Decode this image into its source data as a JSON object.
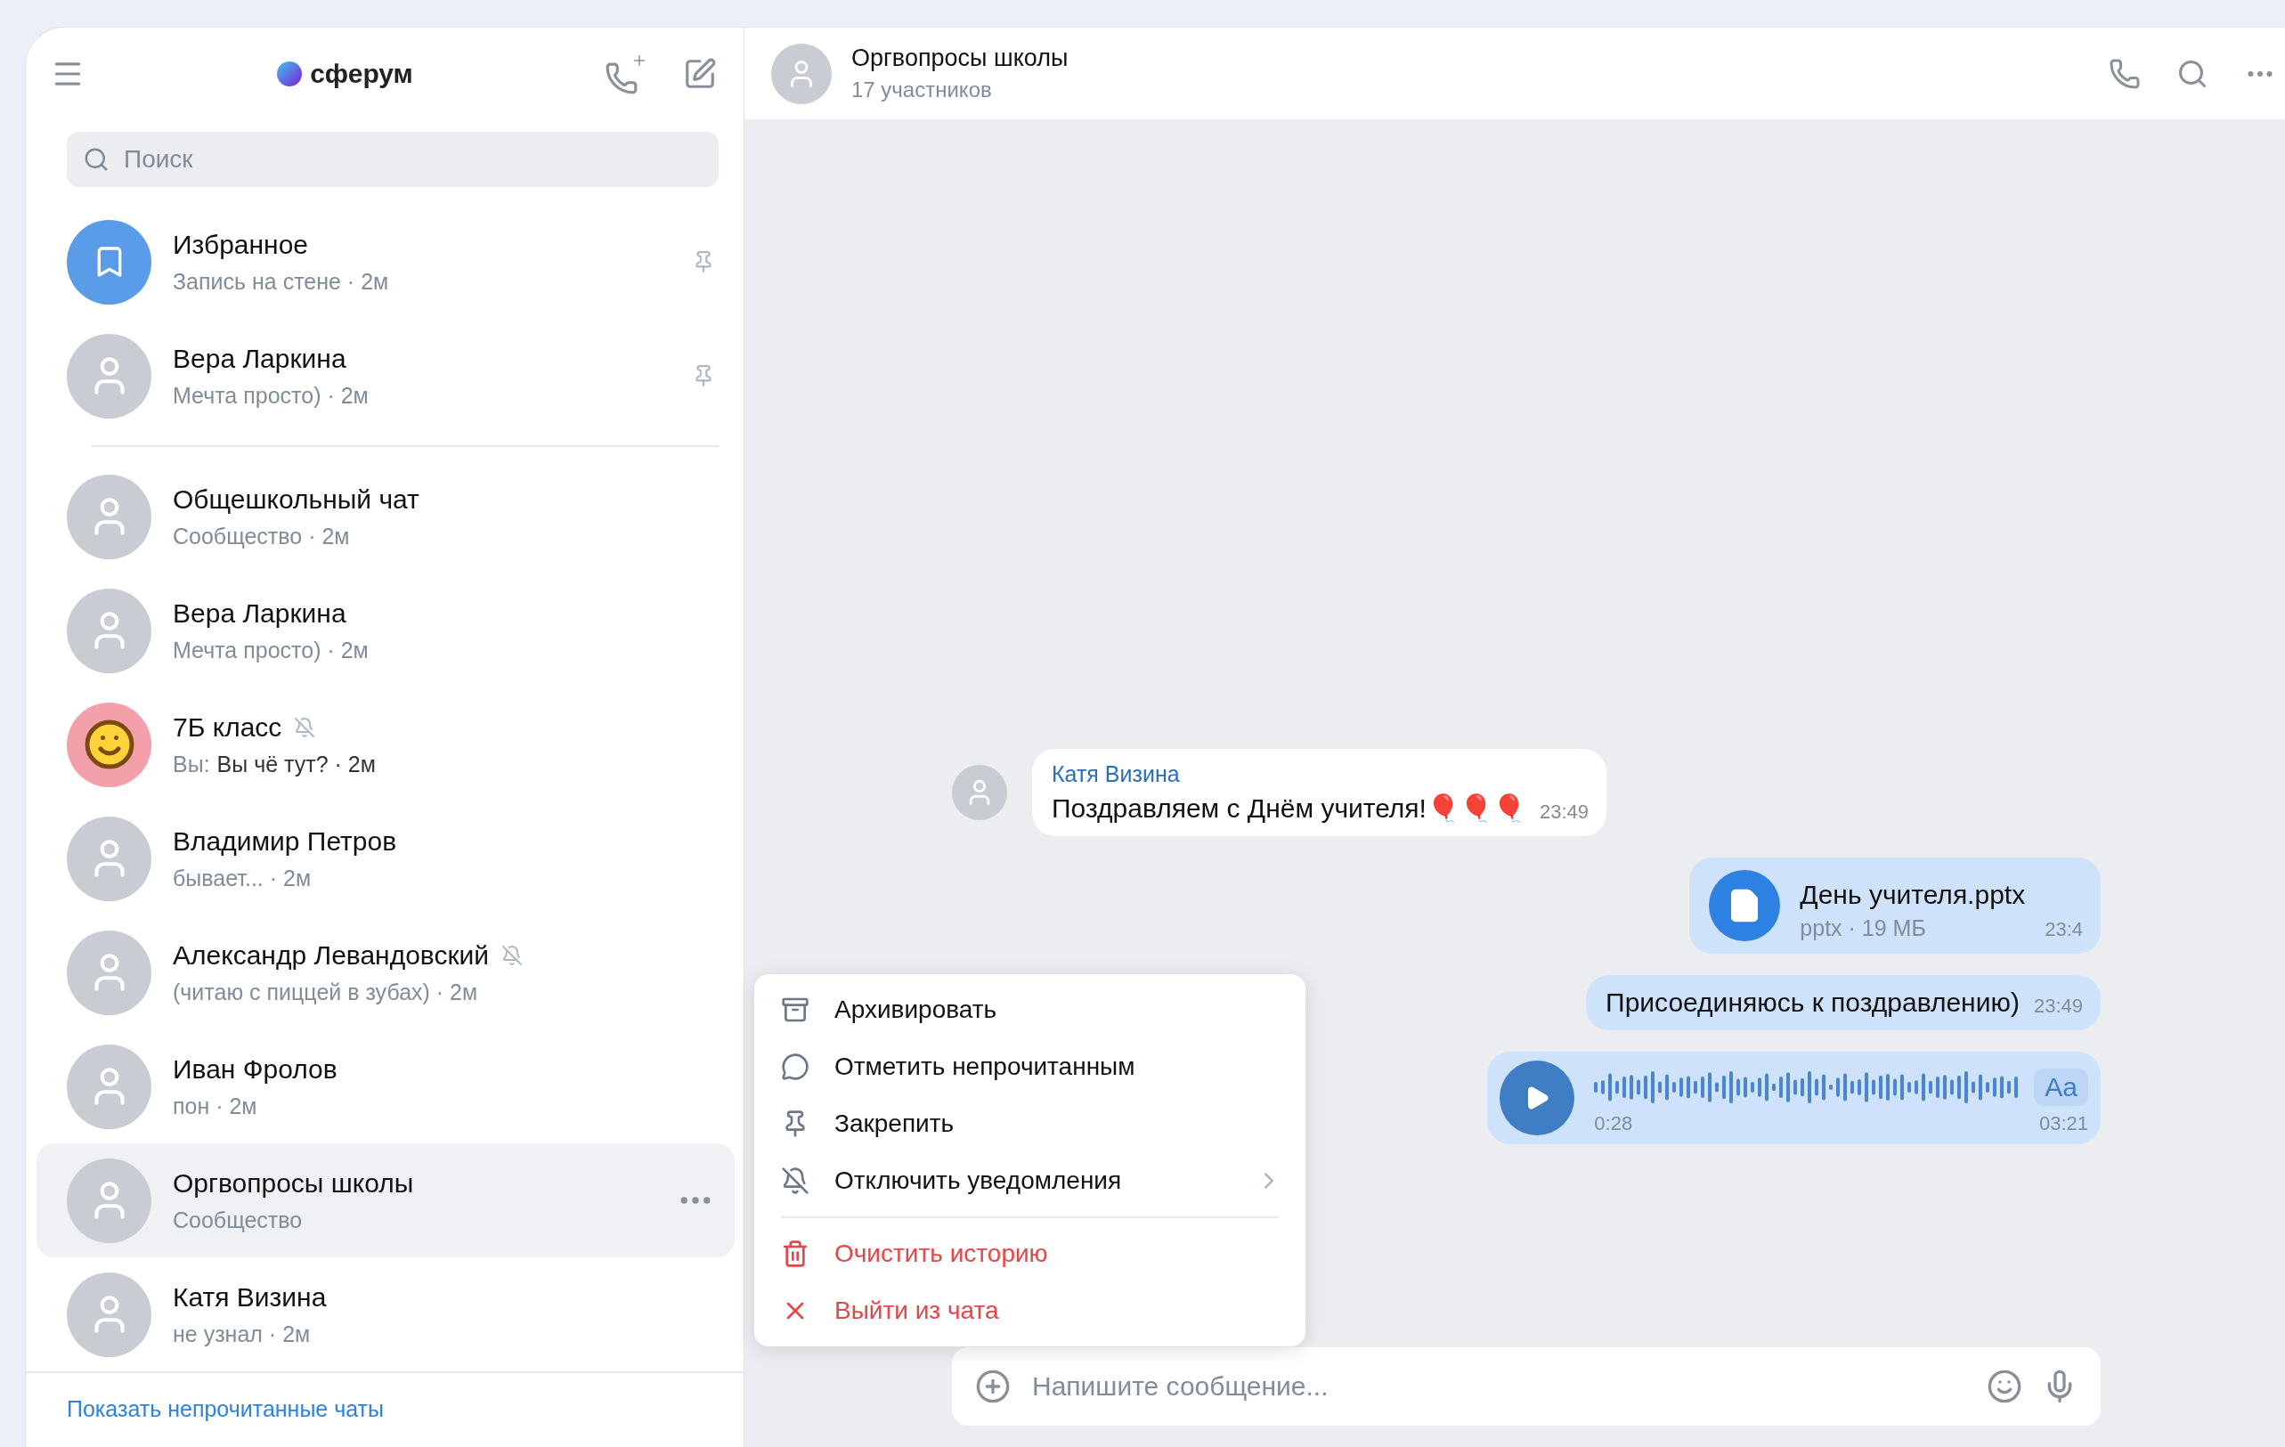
{
  "sidebar": {
    "logo": "сферум",
    "search": {
      "placeholder": "Поиск"
    },
    "chats": [
      {
        "name": "Избранное",
        "kind": "bookmark",
        "subtitle": "Запись на стене · 2м",
        "pinned": true,
        "muted": false,
        "selected": false
      },
      {
        "name": "Вера Ларкина",
        "kind": "photo",
        "subtitle": "Мечта просто) · 2м",
        "pinned": true,
        "muted": false,
        "selected": false
      },
      {
        "name": "Общешкольный чат",
        "kind": "photo",
        "subtitle": "Сообщество · 2м",
        "pinned": false,
        "muted": false,
        "selected": false
      },
      {
        "name": "Вера Ларкина",
        "kind": "photo",
        "subtitle": "Мечта просто) · 2м",
        "pinned": false,
        "muted": false,
        "selected": false
      },
      {
        "name": "7Б класс",
        "kind": "emoji",
        "sender": "Вы:",
        "subtitle": "Вы чё тут? · 2м",
        "pinned": false,
        "muted": true,
        "selected": false
      },
      {
        "name": "Владимир Петров",
        "kind": "photo",
        "subtitle": "бывает... · 2м",
        "pinned": false,
        "muted": false,
        "selected": false
      },
      {
        "name": "Александр Левандовский",
        "kind": "photo",
        "subtitle": "(читаю с пиццей в зубах) · 2м",
        "pinned": false,
        "muted": true,
        "selected": false
      },
      {
        "name": "Иван Фролов",
        "kind": "photo",
        "subtitle": "пон · 2м",
        "pinned": false,
        "muted": false,
        "selected": false
      },
      {
        "name": "Оргвопросы школы",
        "kind": "photo",
        "subtitle": "Сообщество",
        "pinned": false,
        "muted": false,
        "selected": true
      },
      {
        "name": "Катя Визина",
        "kind": "photo",
        "subtitle": "не узнал · 2м",
        "pinned": false,
        "muted": false,
        "selected": false
      }
    ],
    "footer_link": "Показать непрочитанные чаты"
  },
  "chat": {
    "title": "Оргвопросы школы",
    "subtitle": "17 участников",
    "messages": [
      {
        "kind": "text",
        "incoming": true,
        "author": "Катя Визина",
        "text": "Поздравляем с Днём учителя!🎈🎈🎈",
        "time": "23:49"
      },
      {
        "kind": "file",
        "incoming": false,
        "file_name": "День учителя.pptx",
        "file_info": "pptx · 19 МБ",
        "time": "23:4"
      },
      {
        "kind": "text",
        "incoming": false,
        "text": "Присоединяюсь к поздравлению)",
        "time": "23:49"
      },
      {
        "kind": "voice",
        "incoming": false,
        "position": "0:28",
        "duration": "03:21",
        "transcribe": "Aa"
      }
    ],
    "input": {
      "placeholder": "Напишите сообщение..."
    }
  },
  "context_menu": [
    {
      "label": "Архивировать",
      "kind": "archive",
      "danger": false,
      "submenu": false
    },
    {
      "label": "Отметить непрочитанным",
      "kind": "unread",
      "danger": false,
      "submenu": false
    },
    {
      "label": "Закрепить",
      "kind": "pin",
      "danger": false,
      "submenu": false
    },
    {
      "label": "Отключить уведомления",
      "kind": "mute",
      "danger": false,
      "submenu": true
    },
    {
      "label": "Очистить историю",
      "kind": "clear",
      "danger": true,
      "submenu": false
    },
    {
      "label": "Выйти из чата",
      "kind": "leave",
      "danger": true,
      "submenu": false
    }
  ]
}
